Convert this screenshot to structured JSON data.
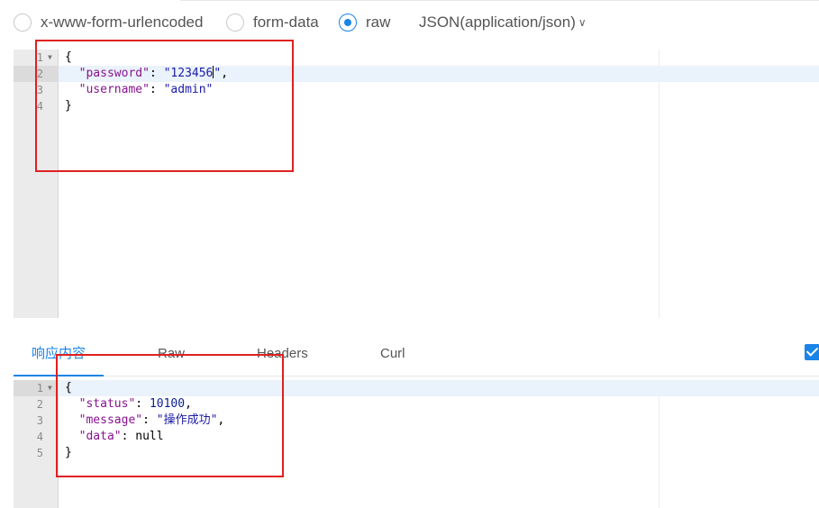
{
  "body_type_options": [
    {
      "label": "x-www-form-urlencoded",
      "selected": false
    },
    {
      "label": "form-data",
      "selected": false
    },
    {
      "label": "raw",
      "selected": true
    }
  ],
  "content_type": {
    "label": "JSON(application/json)",
    "icon": "chevron-down-icon"
  },
  "request_editor": {
    "lines": [
      {
        "num": "1",
        "fold": true,
        "segments": [
          {
            "t": "p",
            "v": "{"
          }
        ]
      },
      {
        "num": "2",
        "fold": false,
        "segments": [
          {
            "t": "p",
            "v": "  "
          },
          {
            "t": "k",
            "v": "\"password\""
          },
          {
            "t": "p",
            "v": ": "
          },
          {
            "t": "s",
            "v": "\"123456\""
          },
          {
            "t": "p",
            "v": ","
          }
        ]
      },
      {
        "num": "3",
        "fold": false,
        "segments": [
          {
            "t": "p",
            "v": "  "
          },
          {
            "t": "k",
            "v": "\"username\""
          },
          {
            "t": "p",
            "v": ": "
          },
          {
            "t": "s",
            "v": "\"admin\""
          }
        ]
      },
      {
        "num": "4",
        "fold": false,
        "segments": [
          {
            "t": "p",
            "v": "}"
          }
        ]
      }
    ]
  },
  "response_tabs": [
    {
      "label": "响应内容",
      "active": true
    },
    {
      "label": "Raw",
      "active": false
    },
    {
      "label": "Headers",
      "active": false
    },
    {
      "label": "Curl",
      "active": false
    }
  ],
  "response_editor": {
    "lines": [
      {
        "num": "1",
        "fold": true,
        "segments": [
          {
            "t": "p",
            "v": "{"
          }
        ]
      },
      {
        "num": "2",
        "fold": false,
        "segments": [
          {
            "t": "p",
            "v": "  "
          },
          {
            "t": "k",
            "v": "\"status\""
          },
          {
            "t": "p",
            "v": ": "
          },
          {
            "t": "n",
            "v": "10100"
          },
          {
            "t": "p",
            "v": ","
          }
        ]
      },
      {
        "num": "3",
        "fold": false,
        "segments": [
          {
            "t": "p",
            "v": "  "
          },
          {
            "t": "k",
            "v": "\"message\""
          },
          {
            "t": "p",
            "v": ": "
          },
          {
            "t": "s",
            "v": "\"操作成功\""
          },
          {
            "t": "p",
            "v": ","
          }
        ]
      },
      {
        "num": "4",
        "fold": false,
        "segments": [
          {
            "t": "p",
            "v": "  "
          },
          {
            "t": "k",
            "v": "\"data\""
          },
          {
            "t": "p",
            "v": ": null"
          }
        ]
      },
      {
        "num": "5",
        "fold": false,
        "segments": [
          {
            "t": "p",
            "v": "}"
          }
        ]
      }
    ]
  },
  "colors": {
    "accent": "#1a84e8",
    "highlight": "#e02020",
    "json_key": "#881391",
    "json_string": "#1a1aa6"
  }
}
